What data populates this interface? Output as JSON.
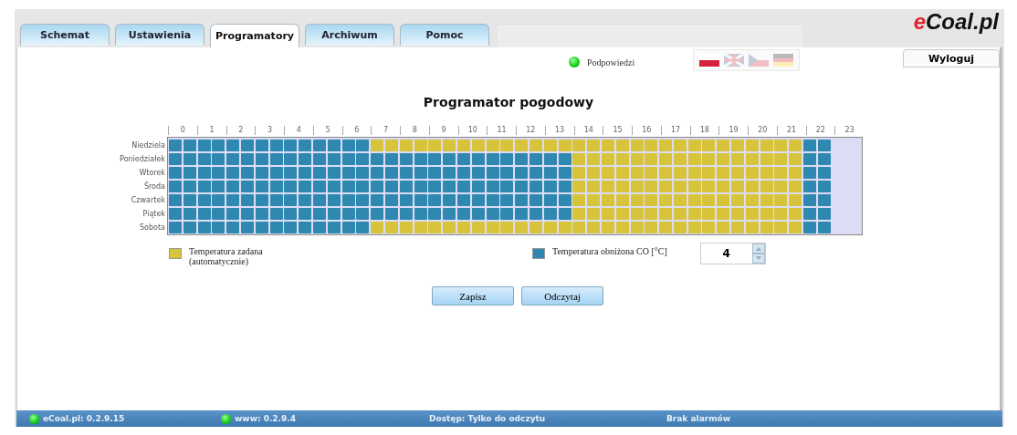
{
  "tabs": [
    {
      "label": "Schemat",
      "selected": false
    },
    {
      "label": "Ustawienia",
      "selected": false
    },
    {
      "label": "Programatory",
      "selected": true
    },
    {
      "label": "Archiwum",
      "selected": false
    },
    {
      "label": "Pomoc",
      "selected": false
    }
  ],
  "logo": {
    "prefix": "e",
    "name": "Coal.pl"
  },
  "hints": {
    "label": "Podpowiedzi",
    "on": true
  },
  "flags": [
    {
      "kind": "pl",
      "selected": true
    },
    {
      "kind": "gb",
      "selected": false
    },
    {
      "kind": "cz",
      "selected": false
    },
    {
      "kind": "de",
      "selected": false
    }
  ],
  "logout": "Wyloguj",
  "title": "Programator pogodowy",
  "hours": [
    "0",
    "1",
    "2",
    "3",
    "4",
    "5",
    "6",
    "7",
    "8",
    "9",
    "10",
    "11",
    "12",
    "13",
    "14",
    "15",
    "16",
    "17",
    "18",
    "19",
    "20",
    "21",
    "22",
    "23"
  ],
  "days": [
    {
      "name": "Niedziela",
      "heated": [
        false,
        false,
        false,
        false,
        false,
        false,
        false,
        false,
        false,
        false,
        false,
        false,
        false,
        false,
        true,
        true,
        true,
        true,
        true,
        true,
        true,
        true,
        true,
        true,
        true,
        true,
        true,
        true,
        true,
        true,
        true,
        true,
        true,
        true,
        true,
        true,
        true,
        true,
        true,
        true,
        true,
        true,
        true,
        true,
        false,
        false
      ]
    },
    {
      "name": "Poniedziałek",
      "heated": [
        false,
        false,
        false,
        false,
        false,
        false,
        false,
        false,
        false,
        false,
        false,
        false,
        false,
        false,
        false,
        false,
        false,
        false,
        false,
        false,
        false,
        false,
        false,
        false,
        false,
        false,
        false,
        false,
        true,
        true,
        true,
        true,
        true,
        true,
        true,
        true,
        true,
        true,
        true,
        true,
        true,
        true,
        true,
        true,
        false,
        false
      ]
    },
    {
      "name": "Wtorek",
      "heated": [
        false,
        false,
        false,
        false,
        false,
        false,
        false,
        false,
        false,
        false,
        false,
        false,
        false,
        false,
        false,
        false,
        false,
        false,
        false,
        false,
        false,
        false,
        false,
        false,
        false,
        false,
        false,
        false,
        true,
        true,
        true,
        true,
        true,
        true,
        true,
        true,
        true,
        true,
        true,
        true,
        true,
        true,
        true,
        true,
        false,
        false
      ]
    },
    {
      "name": "Środa",
      "heated": [
        false,
        false,
        false,
        false,
        false,
        false,
        false,
        false,
        false,
        false,
        false,
        false,
        false,
        false,
        false,
        false,
        false,
        false,
        false,
        false,
        false,
        false,
        false,
        false,
        false,
        false,
        false,
        false,
        true,
        true,
        true,
        true,
        true,
        true,
        true,
        true,
        true,
        true,
        true,
        true,
        true,
        true,
        true,
        true,
        false,
        false
      ]
    },
    {
      "name": "Czwartek",
      "heated": [
        false,
        false,
        false,
        false,
        false,
        false,
        false,
        false,
        false,
        false,
        false,
        false,
        false,
        false,
        false,
        false,
        false,
        false,
        false,
        false,
        false,
        false,
        false,
        false,
        false,
        false,
        false,
        false,
        true,
        true,
        true,
        true,
        true,
        true,
        true,
        true,
        true,
        true,
        true,
        true,
        true,
        true,
        true,
        true,
        false,
        false
      ]
    },
    {
      "name": "Piątek",
      "heated": [
        false,
        false,
        false,
        false,
        false,
        false,
        false,
        false,
        false,
        false,
        false,
        false,
        false,
        false,
        false,
        false,
        false,
        false,
        false,
        false,
        false,
        false,
        false,
        false,
        false,
        false,
        false,
        false,
        true,
        true,
        true,
        true,
        true,
        true,
        true,
        true,
        true,
        true,
        true,
        true,
        true,
        true,
        true,
        true,
        false,
        false
      ]
    },
    {
      "name": "Sobota",
      "heated": [
        false,
        false,
        false,
        false,
        false,
        false,
        false,
        false,
        false,
        false,
        false,
        false,
        false,
        false,
        true,
        true,
        true,
        true,
        true,
        true,
        true,
        true,
        true,
        true,
        true,
        true,
        true,
        true,
        true,
        true,
        true,
        true,
        true,
        true,
        true,
        true,
        true,
        true,
        true,
        true,
        true,
        true,
        true,
        true,
        false,
        false
      ]
    }
  ],
  "legend": [
    {
      "label": "Temperatura zadana (automatycznie)",
      "color": "#d8c43a"
    },
    {
      "label": "Temperatura obniżona CO [°C]",
      "color": "#2f88b0"
    }
  ],
  "reduced_temp": {
    "value": "4"
  },
  "buttons": [
    "Zapisz",
    "Odczytaj"
  ],
  "status_bar": [
    {
      "text": "eCoal.pl: 0.2.9.15",
      "led": true
    },
    {
      "text": "www: 0.2.9.4",
      "led": true
    },
    {
      "text": "Dostęp: Tylko do odczytu",
      "led": false
    },
    {
      "text": "Brak alarmów",
      "led": false
    }
  ]
}
